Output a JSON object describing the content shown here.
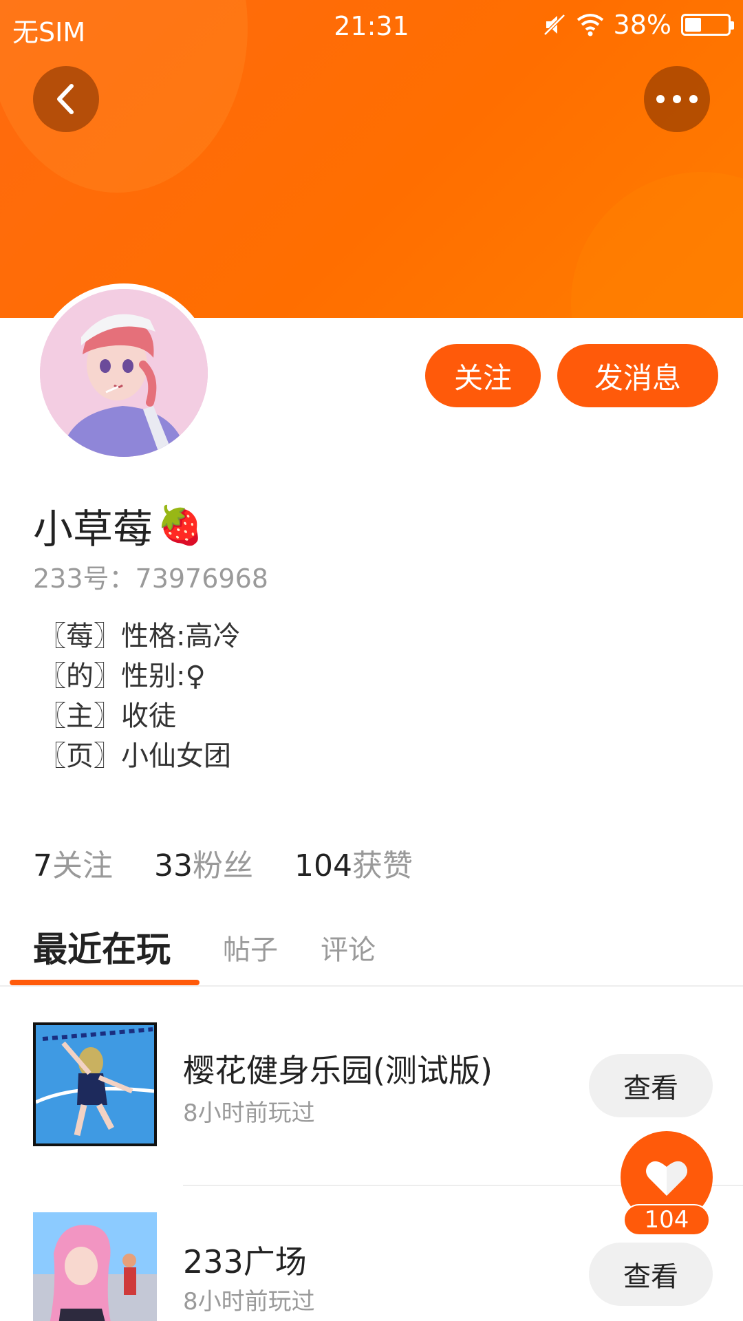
{
  "status_bar": {
    "carrier": "无SIM",
    "time": "21:31",
    "battery": "38%",
    "battery_level": 0.38
  },
  "header": {
    "back_icon": "chevron-left-icon",
    "more_icon": "ellipsis-icon"
  },
  "profile": {
    "name": "小草莓",
    "name_emoji": "🍓",
    "id_line": "233号：73976968",
    "follow_label": "关注",
    "message_label": "发消息",
    "bio": [
      "〖莓〗性格:高冷",
      "〖的〗性别:♀",
      "〖主〗收徒",
      "〖页〗小仙女团"
    ]
  },
  "stats": [
    {
      "value": "7",
      "label": "关注"
    },
    {
      "value": "33",
      "label": "粉丝"
    },
    {
      "value": "104",
      "label": "获赞"
    }
  ],
  "tabs": [
    {
      "label": "最近在玩",
      "active": true
    },
    {
      "label": "帖子",
      "active": false
    },
    {
      "label": "评论",
      "active": false
    }
  ],
  "games": [
    {
      "title": "樱花健身乐园(测试版)",
      "subtitle": "8小时前玩过",
      "button": "查看"
    },
    {
      "title": "233广场",
      "subtitle": "8小时前玩过",
      "button": "查看"
    }
  ],
  "like_fab": {
    "count": "104",
    "icon": "heart-icon"
  },
  "colors": {
    "accent": "#ff5a0a",
    "banner": "#ff6e00"
  }
}
